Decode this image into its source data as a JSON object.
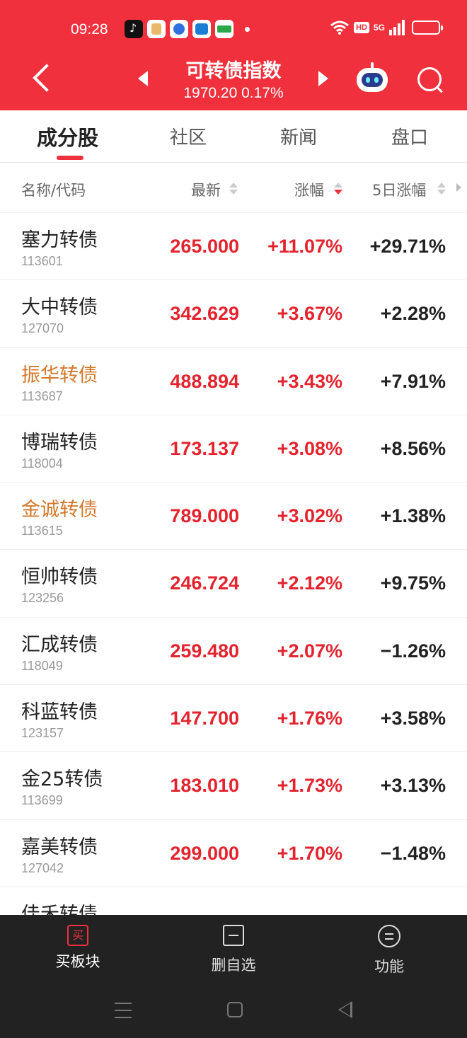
{
  "status_bar": {
    "time": "09:28",
    "network": "5G",
    "hd_badge": "HD",
    "app_icons": [
      "tiktok-icon",
      "app-icon",
      "baidu-icon",
      "app-icon",
      "oppo-icon"
    ]
  },
  "header": {
    "title": "可转债指数",
    "subtitle": "1970.20 0.17%",
    "accent_color": "#f0303c"
  },
  "tabs": [
    {
      "label": "成分股",
      "active": true
    },
    {
      "label": "社区",
      "active": false
    },
    {
      "label": "新闻",
      "active": false
    },
    {
      "label": "盘口",
      "active": false
    }
  ],
  "columns": {
    "name": "名称/代码",
    "price": "最新",
    "change": "涨幅",
    "change5": "5日涨幅",
    "sorted_by": "涨幅",
    "sort_order": "desc"
  },
  "rows": [
    {
      "name": "塞力转债",
      "code": "113601",
      "price": "265.000",
      "change": "+11.07%",
      "change5": "+29.71%",
      "highlight": false
    },
    {
      "name": "大中转债",
      "code": "127070",
      "price": "342.629",
      "change": "+3.67%",
      "change5": "+2.28%",
      "highlight": false
    },
    {
      "name": "振华转债",
      "code": "113687",
      "price": "488.894",
      "change": "+3.43%",
      "change5": "+7.91%",
      "highlight": true
    },
    {
      "name": "博瑞转债",
      "code": "118004",
      "price": "173.137",
      "change": "+3.08%",
      "change5": "+8.56%",
      "highlight": false
    },
    {
      "name": "金诚转债",
      "code": "113615",
      "price": "789.000",
      "change": "+3.02%",
      "change5": "+1.38%",
      "highlight": true
    },
    {
      "name": "恒帅转债",
      "code": "123256",
      "price": "246.724",
      "change": "+2.12%",
      "change5": "+9.75%",
      "highlight": false
    },
    {
      "name": "汇成转债",
      "code": "118049",
      "price": "259.480",
      "change": "+2.07%",
      "change5": "−1.26%",
      "highlight": false
    },
    {
      "name": "科蓝转债",
      "code": "123157",
      "price": "147.700",
      "change": "+1.76%",
      "change5": "+3.58%",
      "highlight": false
    },
    {
      "name": "金25转债",
      "code": "113699",
      "price": "183.010",
      "change": "+1.73%",
      "change5": "+3.13%",
      "highlight": false
    },
    {
      "name": "嘉美转债",
      "code": "127042",
      "price": "299.000",
      "change": "+1.70%",
      "change5": "−1.48%",
      "highlight": false
    },
    {
      "name": "佳禾转债",
      "code": "",
      "price": "",
      "change": "",
      "change5": "",
      "highlight": false
    }
  ],
  "bottom_nav": [
    {
      "label": "买板块",
      "icon_text": "买",
      "icon": "buy-icon"
    },
    {
      "label": "删自选",
      "icon": "remove-watchlist-icon"
    },
    {
      "label": "功能",
      "icon": "functions-icon"
    }
  ],
  "colors": {
    "up": "#e3242f",
    "highlight_name": "#d4782c",
    "neutral": "#222222"
  }
}
